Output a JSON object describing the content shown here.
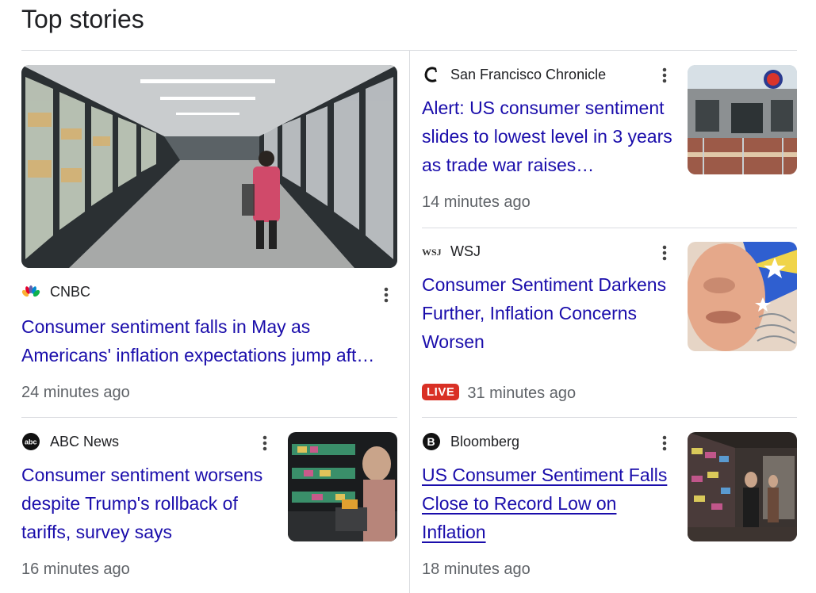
{
  "section": {
    "title": "Top stories"
  },
  "stories": [
    {
      "source": "CNBC",
      "logo_icon": "nbc-peacock-icon",
      "headline": "Consumer sentiment falls in May as Americans' inflation expectations jump aft…",
      "time": "24 minutes ago",
      "thumbnail": "supermarket-freezer-aisle-image"
    },
    {
      "source": "San Francisco Chronicle",
      "logo_icon": "chronicle-c-icon",
      "headline": "Alert: US consumer sentiment slides to lowest level in 3 years as trade war raises…",
      "time": "14 minutes ago",
      "thumbnail": "storefront-building-image"
    },
    {
      "source": "WSJ",
      "logo_icon": "wsj-logo-icon",
      "headline": "Consumer Sentiment Darkens Further, Inflation Concerns Worsen",
      "live": "LIVE",
      "time": "31 minutes ago",
      "thumbnail": "portrait-collage-image"
    },
    {
      "source": "ABC News",
      "logo_icon": "abc-logo-icon",
      "headline": "Consumer sentiment worsens despite Trump's rollback of tariffs, survey says",
      "time": "16 minutes ago",
      "thumbnail": "grocery-shopper-image"
    },
    {
      "source": "Bloomberg",
      "logo_icon": "bloomberg-b-icon",
      "headline": "US Consumer Sentiment Falls Close to Record Low on Inflation",
      "time": "18 minutes ago",
      "thumbnail": "store-shelves-image"
    }
  ],
  "icons": {
    "more": "more-vert-icon"
  },
  "colors": {
    "link": "#1a0dab",
    "live": "#d93025",
    "meta": "#5f6368",
    "divider": "#dadce0"
  }
}
